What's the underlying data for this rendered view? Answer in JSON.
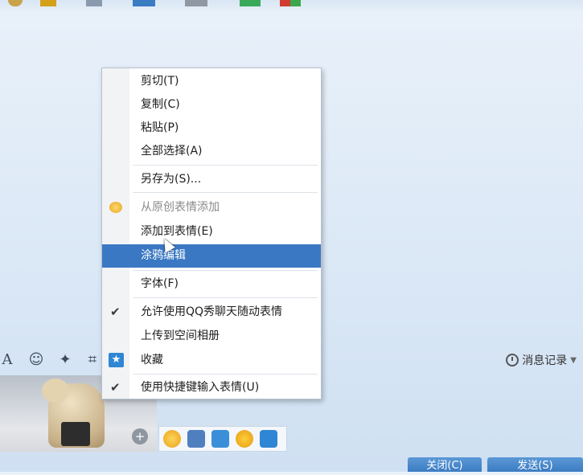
{
  "context_menu": {
    "items": [
      {
        "label": "剪切(T)"
      },
      {
        "label": "复制(C)"
      },
      {
        "label": "粘贴(P)"
      },
      {
        "label": "全部选择(A)"
      },
      {
        "label": "另存为(S)..."
      },
      {
        "label": "从原创表情添加",
        "disabled": true,
        "icon": "emoji-original-icon"
      },
      {
        "label": "添加到表情(E)"
      },
      {
        "label": "涂鸦编辑",
        "highlighted": true
      },
      {
        "label": "字体(F)"
      },
      {
        "label": "允许使用QQ秀聊天随动表情",
        "checked": true
      },
      {
        "label": "上传到空间相册"
      },
      {
        "label": "收藏",
        "icon": "favorite-star-icon"
      },
      {
        "label": "使用快捷键输入表情(U)",
        "checked": true
      }
    ]
  },
  "toolbar": {
    "history_label": "消息记录"
  },
  "buttons": {
    "close_label": "关闭(C)",
    "send_label": "发送(S)"
  },
  "colors": {
    "highlight": "#3a78c3",
    "button": "#4a89cc"
  }
}
